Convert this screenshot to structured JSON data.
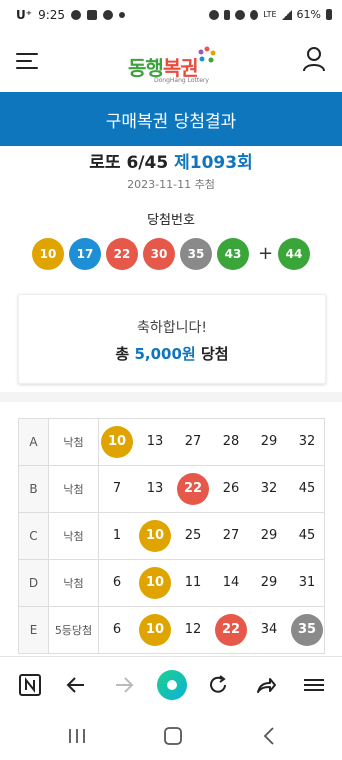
{
  "status_bar": {
    "carrier": "U⁺",
    "time": "9:25",
    "signal_label": "LTE",
    "battery": "61%"
  },
  "header": {
    "logo_text_part1": "동행",
    "logo_text_part2": "복권",
    "logo_sub": "DongHang Lottery",
    "title": "구매복권 당첨결과"
  },
  "draw": {
    "name": "로또 6/45",
    "round": "제1093회",
    "date": "2023-11-11 추첨",
    "winning_label": "당첨번호",
    "plus": "+",
    "winning_numbers": [
      {
        "value": "10",
        "color": "#e0a400"
      },
      {
        "value": "17",
        "color": "#1e8ed6"
      },
      {
        "value": "22",
        "color": "#e5584a"
      },
      {
        "value": "30",
        "color": "#e5584a"
      },
      {
        "value": "35",
        "color": "#8a8a8a"
      },
      {
        "value": "43",
        "color": "#3aa63a"
      }
    ],
    "bonus": {
      "value": "44",
      "color": "#3aa63a"
    }
  },
  "congrats": {
    "message": "축하합니다!",
    "prize_prefix": "총",
    "amount": "5,000원",
    "prize_suffix": "당첨"
  },
  "results": [
    {
      "label": "A",
      "result": "낙첨",
      "numbers": [
        {
          "v": "10",
          "color": "#e0a400"
        },
        {
          "v": "13"
        },
        {
          "v": "27"
        },
        {
          "v": "28"
        },
        {
          "v": "29"
        },
        {
          "v": "32"
        }
      ]
    },
    {
      "label": "B",
      "result": "낙첨",
      "numbers": [
        {
          "v": "7"
        },
        {
          "v": "13"
        },
        {
          "v": "22",
          "color": "#e5584a"
        },
        {
          "v": "26"
        },
        {
          "v": "32"
        },
        {
          "v": "45"
        }
      ]
    },
    {
      "label": "C",
      "result": "낙첨",
      "numbers": [
        {
          "v": "1"
        },
        {
          "v": "10",
          "color": "#e0a400"
        },
        {
          "v": "25"
        },
        {
          "v": "27"
        },
        {
          "v": "29"
        },
        {
          "v": "45"
        }
      ]
    },
    {
      "label": "D",
      "result": "낙첨",
      "numbers": [
        {
          "v": "6"
        },
        {
          "v": "10",
          "color": "#e0a400"
        },
        {
          "v": "11"
        },
        {
          "v": "14"
        },
        {
          "v": "29"
        },
        {
          "v": "31"
        }
      ]
    },
    {
      "label": "E",
      "result": "5등당첨",
      "numbers": [
        {
          "v": "6"
        },
        {
          "v": "10",
          "color": "#e0a400"
        },
        {
          "v": "12"
        },
        {
          "v": "22",
          "color": "#e5584a"
        },
        {
          "v": "34"
        },
        {
          "v": "35",
          "color": "#8a8a8a"
        }
      ]
    }
  ],
  "browser_toolbar": {
    "items": [
      "naver-icon",
      "back-icon",
      "forward-icon",
      "home-dot-icon",
      "refresh-icon",
      "share-icon",
      "menu-icon"
    ]
  },
  "system_nav": {
    "items": [
      "recent-apps-icon",
      "home-icon",
      "back-icon"
    ]
  },
  "colors": {
    "brand_blue": "#0e76bd",
    "ball_yellow": "#e0a400",
    "ball_blue": "#1e8ed6",
    "ball_red": "#e5584a",
    "ball_gray": "#8a8a8a",
    "ball_green": "#3aa63a"
  }
}
